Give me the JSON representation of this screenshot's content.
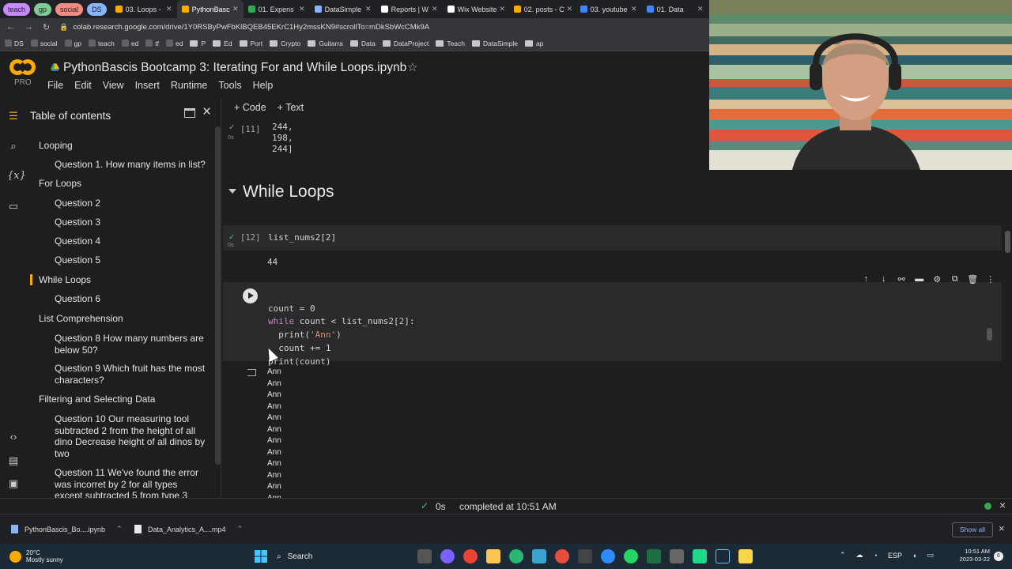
{
  "browser": {
    "tab_groups": [
      {
        "label": "teach",
        "color": "#c58af9"
      },
      {
        "label": "gp",
        "color": "#81c995"
      },
      {
        "label": "social",
        "color": "#f28b82"
      },
      {
        "label": "DS",
        "color": "#8ab4f8"
      }
    ],
    "tabs": [
      {
        "label": "03. Loops -",
        "color": "#f9ab00",
        "active": false
      },
      {
        "label": "PythonBasc",
        "color": "#f9ab00",
        "active": true
      },
      {
        "label": "01. Expens",
        "color": "#34a853",
        "active": false
      },
      {
        "label": "DataSimple",
        "color": "#8ab4f8",
        "active": false
      },
      {
        "label": "Reports | W",
        "color": "#ffffff",
        "active": false
      },
      {
        "label": "Wix Website",
        "color": "#ffffff",
        "active": false
      },
      {
        "label": "02. posts - C",
        "color": "#f9ab00",
        "active": false
      },
      {
        "label": "03. youtube",
        "color": "#4285f4",
        "active": false
      },
      {
        "label": "01. Data",
        "color": "#4285f4",
        "active": false
      }
    ],
    "url": "colab.research.google.com/drive/1Y0RSByPwFbKlBQEB45EKrC1Hy2mssKN9#scrollTo=mDkSbWcCMk9A",
    "bookmarks": [
      "DS",
      "social",
      "gp",
      "teach",
      "ed",
      "tf",
      "ed",
      "P",
      "Ed",
      "Port",
      "Crypto",
      "Guitarra",
      "Data",
      "DataProject",
      "Teach",
      "DataSimple",
      "ap"
    ]
  },
  "notebook": {
    "title": "PythonBascis Bootcamp 3: Iterating For and While Loops.ipynb",
    "pro_label": "PRO",
    "menu": [
      "File",
      "Edit",
      "View",
      "Insert",
      "Runtime",
      "Tools",
      "Help"
    ],
    "toolbar": {
      "code": "+ Code",
      "text": "+ Text"
    }
  },
  "toc": {
    "title": "Table of contents",
    "items": [
      {
        "label": "Looping",
        "level": 1
      },
      {
        "label": "Question 1. How many items in list?",
        "level": 2
      },
      {
        "label": "For Loops",
        "level": 1
      },
      {
        "label": "Question 2",
        "level": 2
      },
      {
        "label": "Question 3",
        "level": 2
      },
      {
        "label": "Question 4",
        "level": 2
      },
      {
        "label": "Question 5",
        "level": 2
      },
      {
        "label": "While Loops",
        "level": 1,
        "active": true
      },
      {
        "label": "Question 6",
        "level": 2
      },
      {
        "label": "List Comprehension",
        "level": 1
      },
      {
        "label": "Question 8 How many numbers are below 50?",
        "level": 2
      },
      {
        "label": "Question 9 Which fruit has the most characters?",
        "level": 2
      },
      {
        "label": "Filtering and Selecting Data",
        "level": 1
      },
      {
        "label": "Question 10 Our measuring tool subtracted 2 from the height of all dino Decrease height of all dinos by two",
        "level": 2
      },
      {
        "label": "Question 11 We've found the error was incorret by 2 for all types except subtracted 5 from type 3",
        "level": 2
      }
    ]
  },
  "cells": {
    "cell11": {
      "number": "[11]",
      "secs": "0s",
      "output": [
        "244,",
        "198,",
        "244]"
      ]
    },
    "section": "While Loops",
    "cell12": {
      "number": "[12]",
      "secs": "0s",
      "code": "list_nums2[2]",
      "output": "44"
    },
    "cell13": {
      "code_lines": [
        "count = 0",
        "while count < list_nums2[2]:",
        "  print('Ann')",
        "  count += 1",
        "print(count)"
      ],
      "output_lines": [
        "Ann",
        "Ann",
        "Ann",
        "Ann",
        "Ann",
        "Ann",
        "Ann",
        "Ann",
        "Ann",
        "Ann",
        "Ann",
        "Ann"
      ]
    }
  },
  "status": {
    "check": "✓",
    "time": "0s",
    "message": "completed at 10:51 AM"
  },
  "downloads": [
    {
      "name": "PythonBascis_Bo....ipynb"
    },
    {
      "name": "Data_Analytics_A....mp4"
    }
  ],
  "download_show_all": "Show all",
  "taskbar": {
    "temp": "20°C",
    "weather": "Mostly sunny",
    "search": "Search",
    "lang": "ESP",
    "time": "10:51 AM",
    "date": "2023-03-22"
  }
}
